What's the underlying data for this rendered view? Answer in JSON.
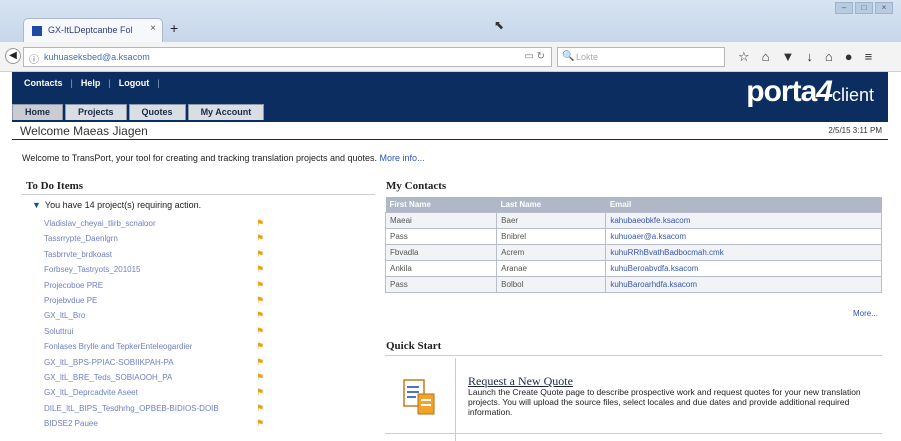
{
  "browser": {
    "tab_title": "GX-ItLDeptcanbe Fol",
    "tab_close": "×",
    "new_tab": "+",
    "url": "kuhuaseksbed@a.ksacom",
    "search_placeholder": "Lokte",
    "window_buttons": [
      "–",
      "□",
      "×"
    ]
  },
  "app": {
    "top_nav": [
      "Contacts",
      "Help",
      "Logout"
    ],
    "logo_main": "porta",
    "logo_accent": "client",
    "tabs": [
      "Home",
      "Projects",
      "Quotes",
      "My Account"
    ],
    "welcome": "Welcome",
    "welcome_name": "Maeas Jiagen",
    "date": "2/5/15 3:11 PM",
    "intro_text": "Welcome to TransPort, your tool for creating and tracking translation projects and quotes.",
    "intro_more": "More info..."
  },
  "todo": {
    "title": "To Do Items",
    "summary": "You have 14 project(s) requiring action.",
    "items": [
      "Vladislav_cheyai_tlirb_scnaloor",
      "Tassrrypte_Daenlgrn",
      "Tasbrrvte_brdkoast",
      "Forbsey_Tastryots_201015",
      "Projecoboe PRE",
      "Projebvdue PE",
      "GX_ltL_Bro",
      "Soluttrui",
      "Fonlases Brylle and TepkerEnteleogardier",
      "GX_ltL_BPS-PPIAC-SOBIIKPAH-PA",
      "GX_ltL_BRE_Teds_SOBIAOOH_PA",
      "GX_ltL_Deprcadvite Aseet",
      "DILE_ltL_BIPS_Tesdhrhg_OPBEB-BIDIOS-DOIB",
      "BIDSE2 Pauee"
    ],
    "flag_icon": "flag-icon"
  },
  "contacts": {
    "title": "My Contacts",
    "headers": [
      "First Name",
      "Last Name",
      "Email"
    ],
    "rows": [
      [
        "Maeai",
        "Baer",
        "kahubaeobkfe.ksacom"
      ],
      [
        "Pass",
        "Bnibrel",
        "kuhuoaer@a.ksacom"
      ],
      [
        "Fbvadla",
        "Acrem",
        "kuhuRRhBvathBadbocmah.cmk"
      ],
      [
        "Ankila",
        "Aranae",
        "kuhuBeroabvdfa.ksacom"
      ],
      [
        "Pass",
        "Bolbol",
        "kuhuBaroarhdfa.ksacom"
      ]
    ],
    "more": "More..."
  },
  "quick_start": {
    "title": "Quick Start",
    "heading": "Request a New Quote",
    "description": "Launch the Create Quote page to describe prospective work and request quotes for your new translation projects. You will upload the source files, select locales and due dates and provide additional required information."
  }
}
